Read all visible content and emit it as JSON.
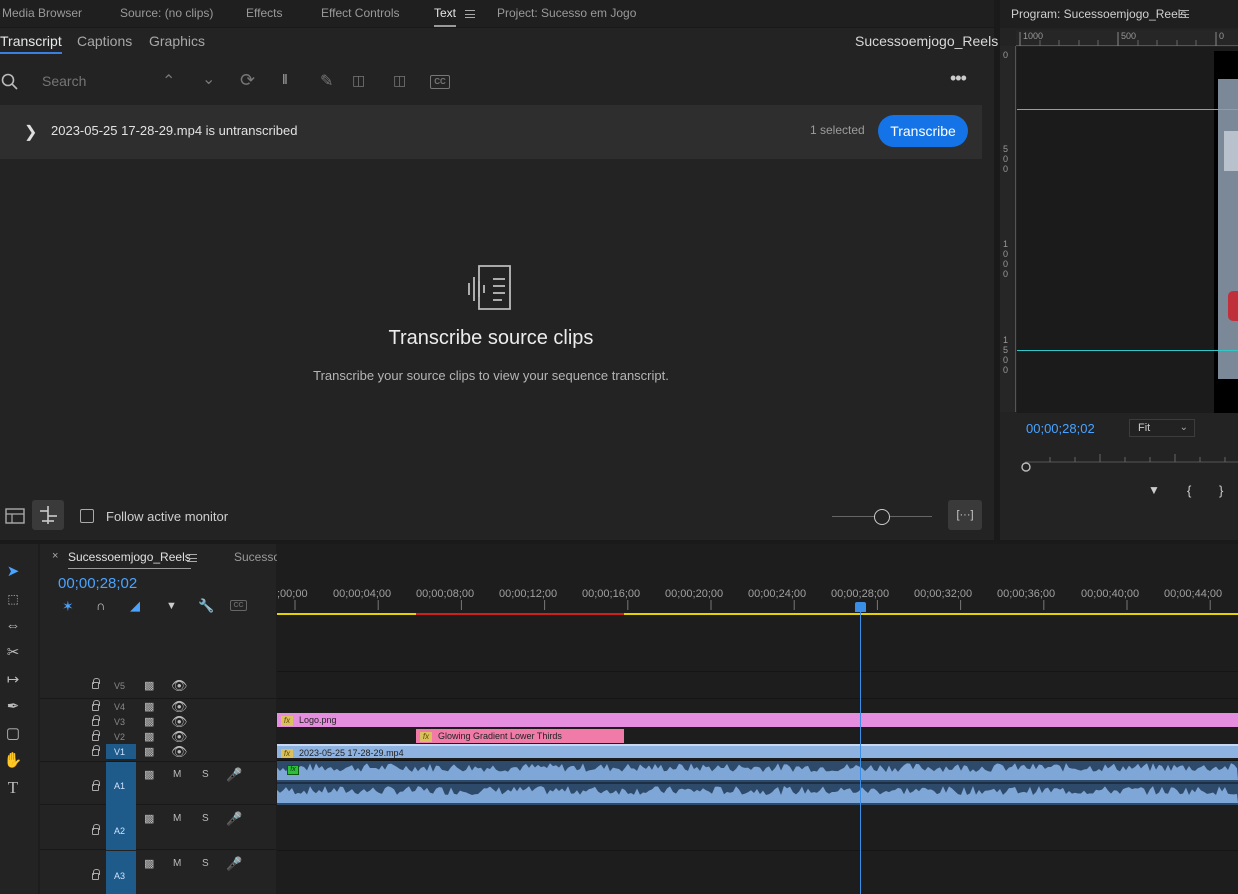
{
  "panel_tabs": [
    "Media Browser",
    "Source: (no clips)",
    "Effects",
    "Effect Controls",
    "Text",
    "Project: Sucesso em Jogo"
  ],
  "sub_tabs": [
    "Transcript",
    "Captions",
    "Graphics"
  ],
  "sequence_name": "Sucessoemjogo_Reels",
  "search": {
    "placeholder": "Search"
  },
  "clip_bar": {
    "message": "2023-05-25 17-28-29.mp4 is untranscribed",
    "selected": "1 selected",
    "button": "Transcribe"
  },
  "empty_state": {
    "title": "Transcribe source clips",
    "description": "Transcribe your source clips to view your sequence transcript."
  },
  "footer": {
    "follow_label": "Follow active monitor",
    "more_label": "[···]"
  },
  "program": {
    "title": "Program: Sucessoemjogo_Reels",
    "timecode": "00;00;28;02",
    "zoom": "Fit",
    "ruler_top": [
      "1000",
      "500",
      "0"
    ],
    "ruler_left": [
      "0",
      "5 0 0",
      "1 0 0 0",
      "1 5 0 0"
    ]
  },
  "timeline": {
    "tabs": [
      "Sucessoemjogo_Reels",
      "SucessoemJogo_FullHD"
    ],
    "timecode": "00;00;28;02",
    "ruler": [
      ";00;00",
      "00;00;04;00",
      "00;00;08;00",
      "00;00;12;00",
      "00;00;16;00",
      "00;00;20;00",
      "00;00;24;00",
      "00;00;28;00",
      "00;00;32;00",
      "00;00;36;00",
      "00;00;40;00",
      "00;00;44;00"
    ],
    "video_tracks": [
      "V5",
      "V4",
      "V3",
      "V2",
      "V1"
    ],
    "audio_tracks": [
      "A1",
      "A2",
      "A3"
    ],
    "mute": "M",
    "solo": "S",
    "clips": {
      "logo": "Logo.png",
      "lower_thirds": "Glowing Gradient Lower Thirds",
      "video": "2023-05-25 17-28-29.mp4"
    },
    "fx": "fx"
  },
  "colors": {
    "accent_blue": "#1473e6",
    "timecode_blue": "#4aa3ff",
    "logo_clip": "#e58ee0",
    "lower_thirds_clip": "#f07aa8",
    "video_clip": "#8fb3e0",
    "audio_clip": "#2e4a6b",
    "audio_wave": "#7ea6d6"
  }
}
